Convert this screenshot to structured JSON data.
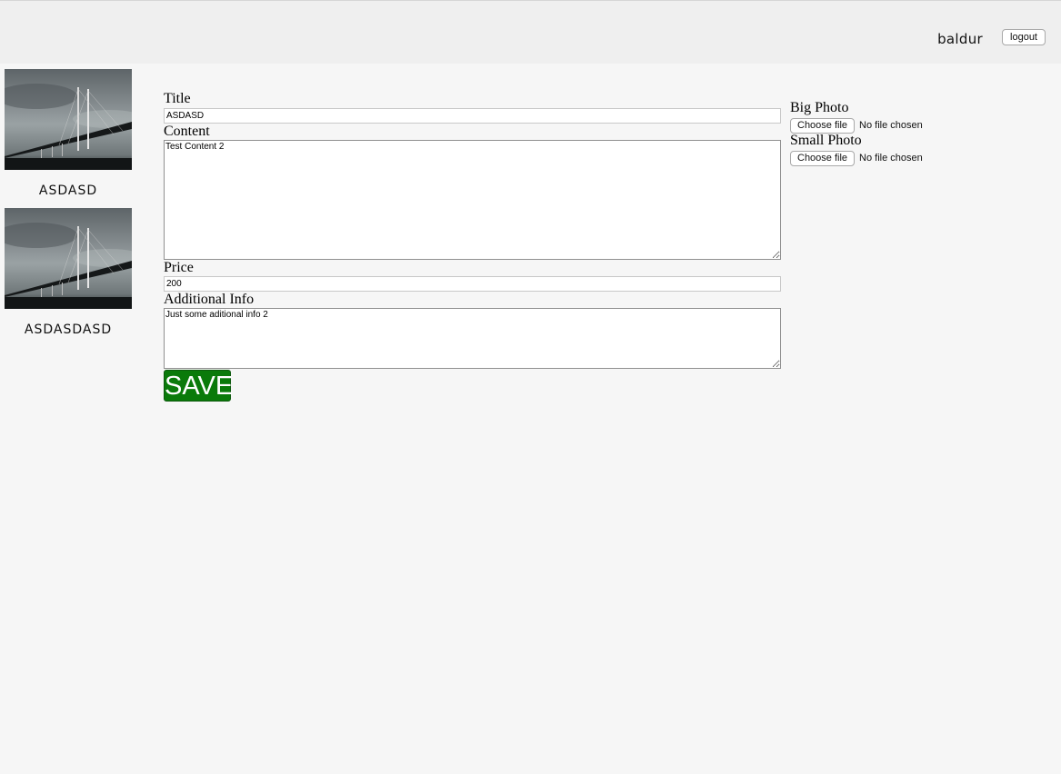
{
  "header": {
    "username": "baldur",
    "logout_label": "logout"
  },
  "sidebar": {
    "items": [
      {
        "title": "ASDASD",
        "image": "bridge-photo"
      },
      {
        "title": "ASDASDASD",
        "image": "bridge-photo"
      }
    ]
  },
  "form": {
    "title_label": "Title",
    "title_value": "ASDASD",
    "content_label": "Content",
    "content_value": "Test Content 2",
    "price_label": "Price",
    "price_value": "200",
    "additional_label": "Additional Info",
    "additional_value": "Just some aditional info 2",
    "save_label": "SAVE",
    "save_color": "#0a7a0a"
  },
  "photos": {
    "big_label": "Big Photo",
    "small_label": "Small Photo",
    "choose_label": "Choose file",
    "no_file_text": "No file chosen"
  }
}
